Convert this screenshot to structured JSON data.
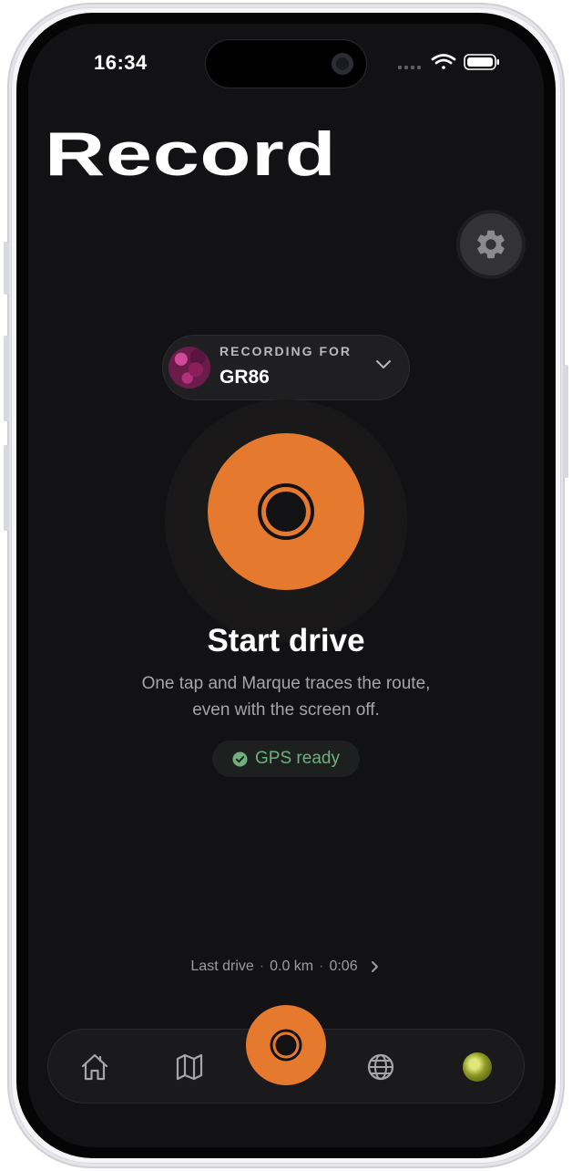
{
  "status_bar": {
    "time": "16:34"
  },
  "page": {
    "title": "Record"
  },
  "settings": {
    "icon": "gear-icon"
  },
  "recording_picker": {
    "kicker": "RECORDING FOR",
    "vehicle": "GR86",
    "icon": "chevron-down-icon"
  },
  "record_control": {
    "heading": "Start drive",
    "subtitle_line1": "One tap and Marque traces the route,",
    "subtitle_line2": "even with the screen off.",
    "gps_status": "GPS ready"
  },
  "last_drive": {
    "label": "Last drive",
    "distance": "0.0 km",
    "duration": "0:06"
  },
  "tab_bar": {
    "items": [
      {
        "icon": "home-icon"
      },
      {
        "icon": "map-icon"
      },
      {
        "icon": "record-icon"
      },
      {
        "icon": "globe-icon"
      },
      {
        "icon": "profile-avatar"
      }
    ]
  },
  "colors": {
    "accent": "#e57a2e",
    "background": "#121214",
    "success": "#6fb07f"
  }
}
